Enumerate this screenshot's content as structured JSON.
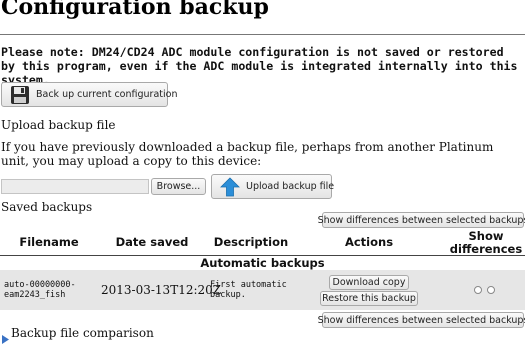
{
  "page": {
    "title": "Configuration backup",
    "note": "Please note: DM24/CD24 ADC module configuration is not saved or restored by this program, even if the ADC module is integrated internally into this system."
  },
  "backup": {
    "button_label": "Back up current configuration",
    "icon": "floppy-disk-icon"
  },
  "upload": {
    "heading": "Upload backup file",
    "description": "If you have previously downloaded a backup file, perhaps from another Platinum unit, you may upload a copy to this device:",
    "browse_label": "Browse...",
    "upload_button_label": "Upload backup file",
    "upload_icon": "arrow-up-icon"
  },
  "saved": {
    "heading": "Saved backups",
    "show_diff_label": "Show differences between selected backups",
    "columns": [
      "Filename",
      "Date saved",
      "Description",
      "Actions",
      "Show differences"
    ],
    "group_label": "Automatic backups",
    "rows": [
      {
        "filename": "auto-00000000-eam2243_fish",
        "date": "2013-03-13T12:20Z",
        "description": "First automatic backup.",
        "download_label": "Download copy",
        "restore_label": "Restore this backup"
      }
    ]
  },
  "comparison": {
    "label": "Backup file comparison",
    "icon": "triangle-right-icon"
  },
  "colors": {
    "button_border": "#a9a9a9",
    "upload_arrow": "#2b8ed8",
    "row_background": "#e6e6e6"
  }
}
